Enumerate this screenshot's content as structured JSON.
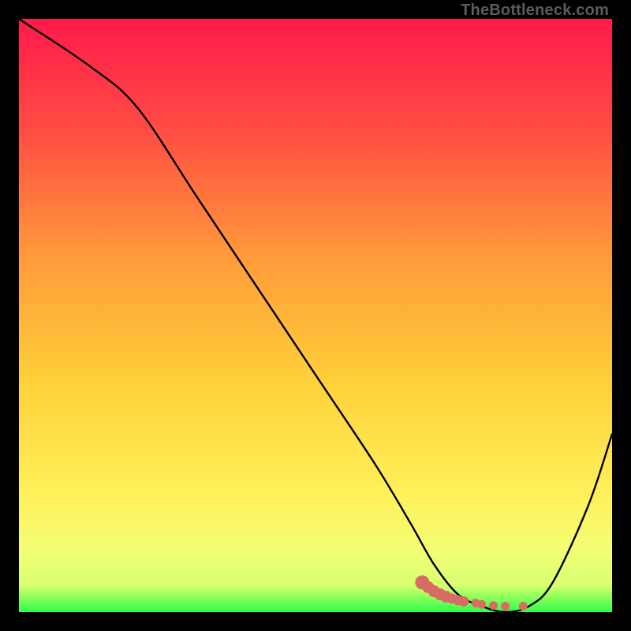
{
  "watermark": "TheBottleneck.com",
  "colors": {
    "gradient_top": "#ff1a4b",
    "gradient_mid1": "#ff8a3a",
    "gradient_mid2": "#ffe53b",
    "gradient_low": "#f6ff6e",
    "gradient_green": "#2eff4a",
    "curve": "#000000",
    "marker": "#d96b65"
  },
  "chart_data": {
    "type": "line",
    "title": "",
    "xlabel": "",
    "ylabel": "",
    "xlim": [
      0,
      100
    ],
    "ylim": [
      0,
      100
    ],
    "grid": false,
    "legend": false,
    "series": [
      {
        "name": "bottleneck-curve",
        "x": [
          0,
          12,
          20,
          30,
          40,
          50,
          60,
          66,
          70,
          74,
          78,
          82,
          86,
          90,
          96,
          100
        ],
        "y": [
          100,
          92,
          85,
          70,
          55,
          40,
          25,
          15,
          8,
          3,
          1,
          0,
          1,
          5,
          18,
          30
        ]
      }
    ],
    "markers": {
      "name": "highlight-dots",
      "x": [
        68,
        69,
        70,
        71,
        72,
        73,
        74,
        75,
        77,
        78,
        80,
        82,
        85
      ],
      "y": [
        5,
        4.2,
        3.5,
        3,
        2.6,
        2.3,
        2.0,
        1.8,
        1.5,
        1.3,
        1.1,
        1.0,
        1.0
      ]
    }
  }
}
